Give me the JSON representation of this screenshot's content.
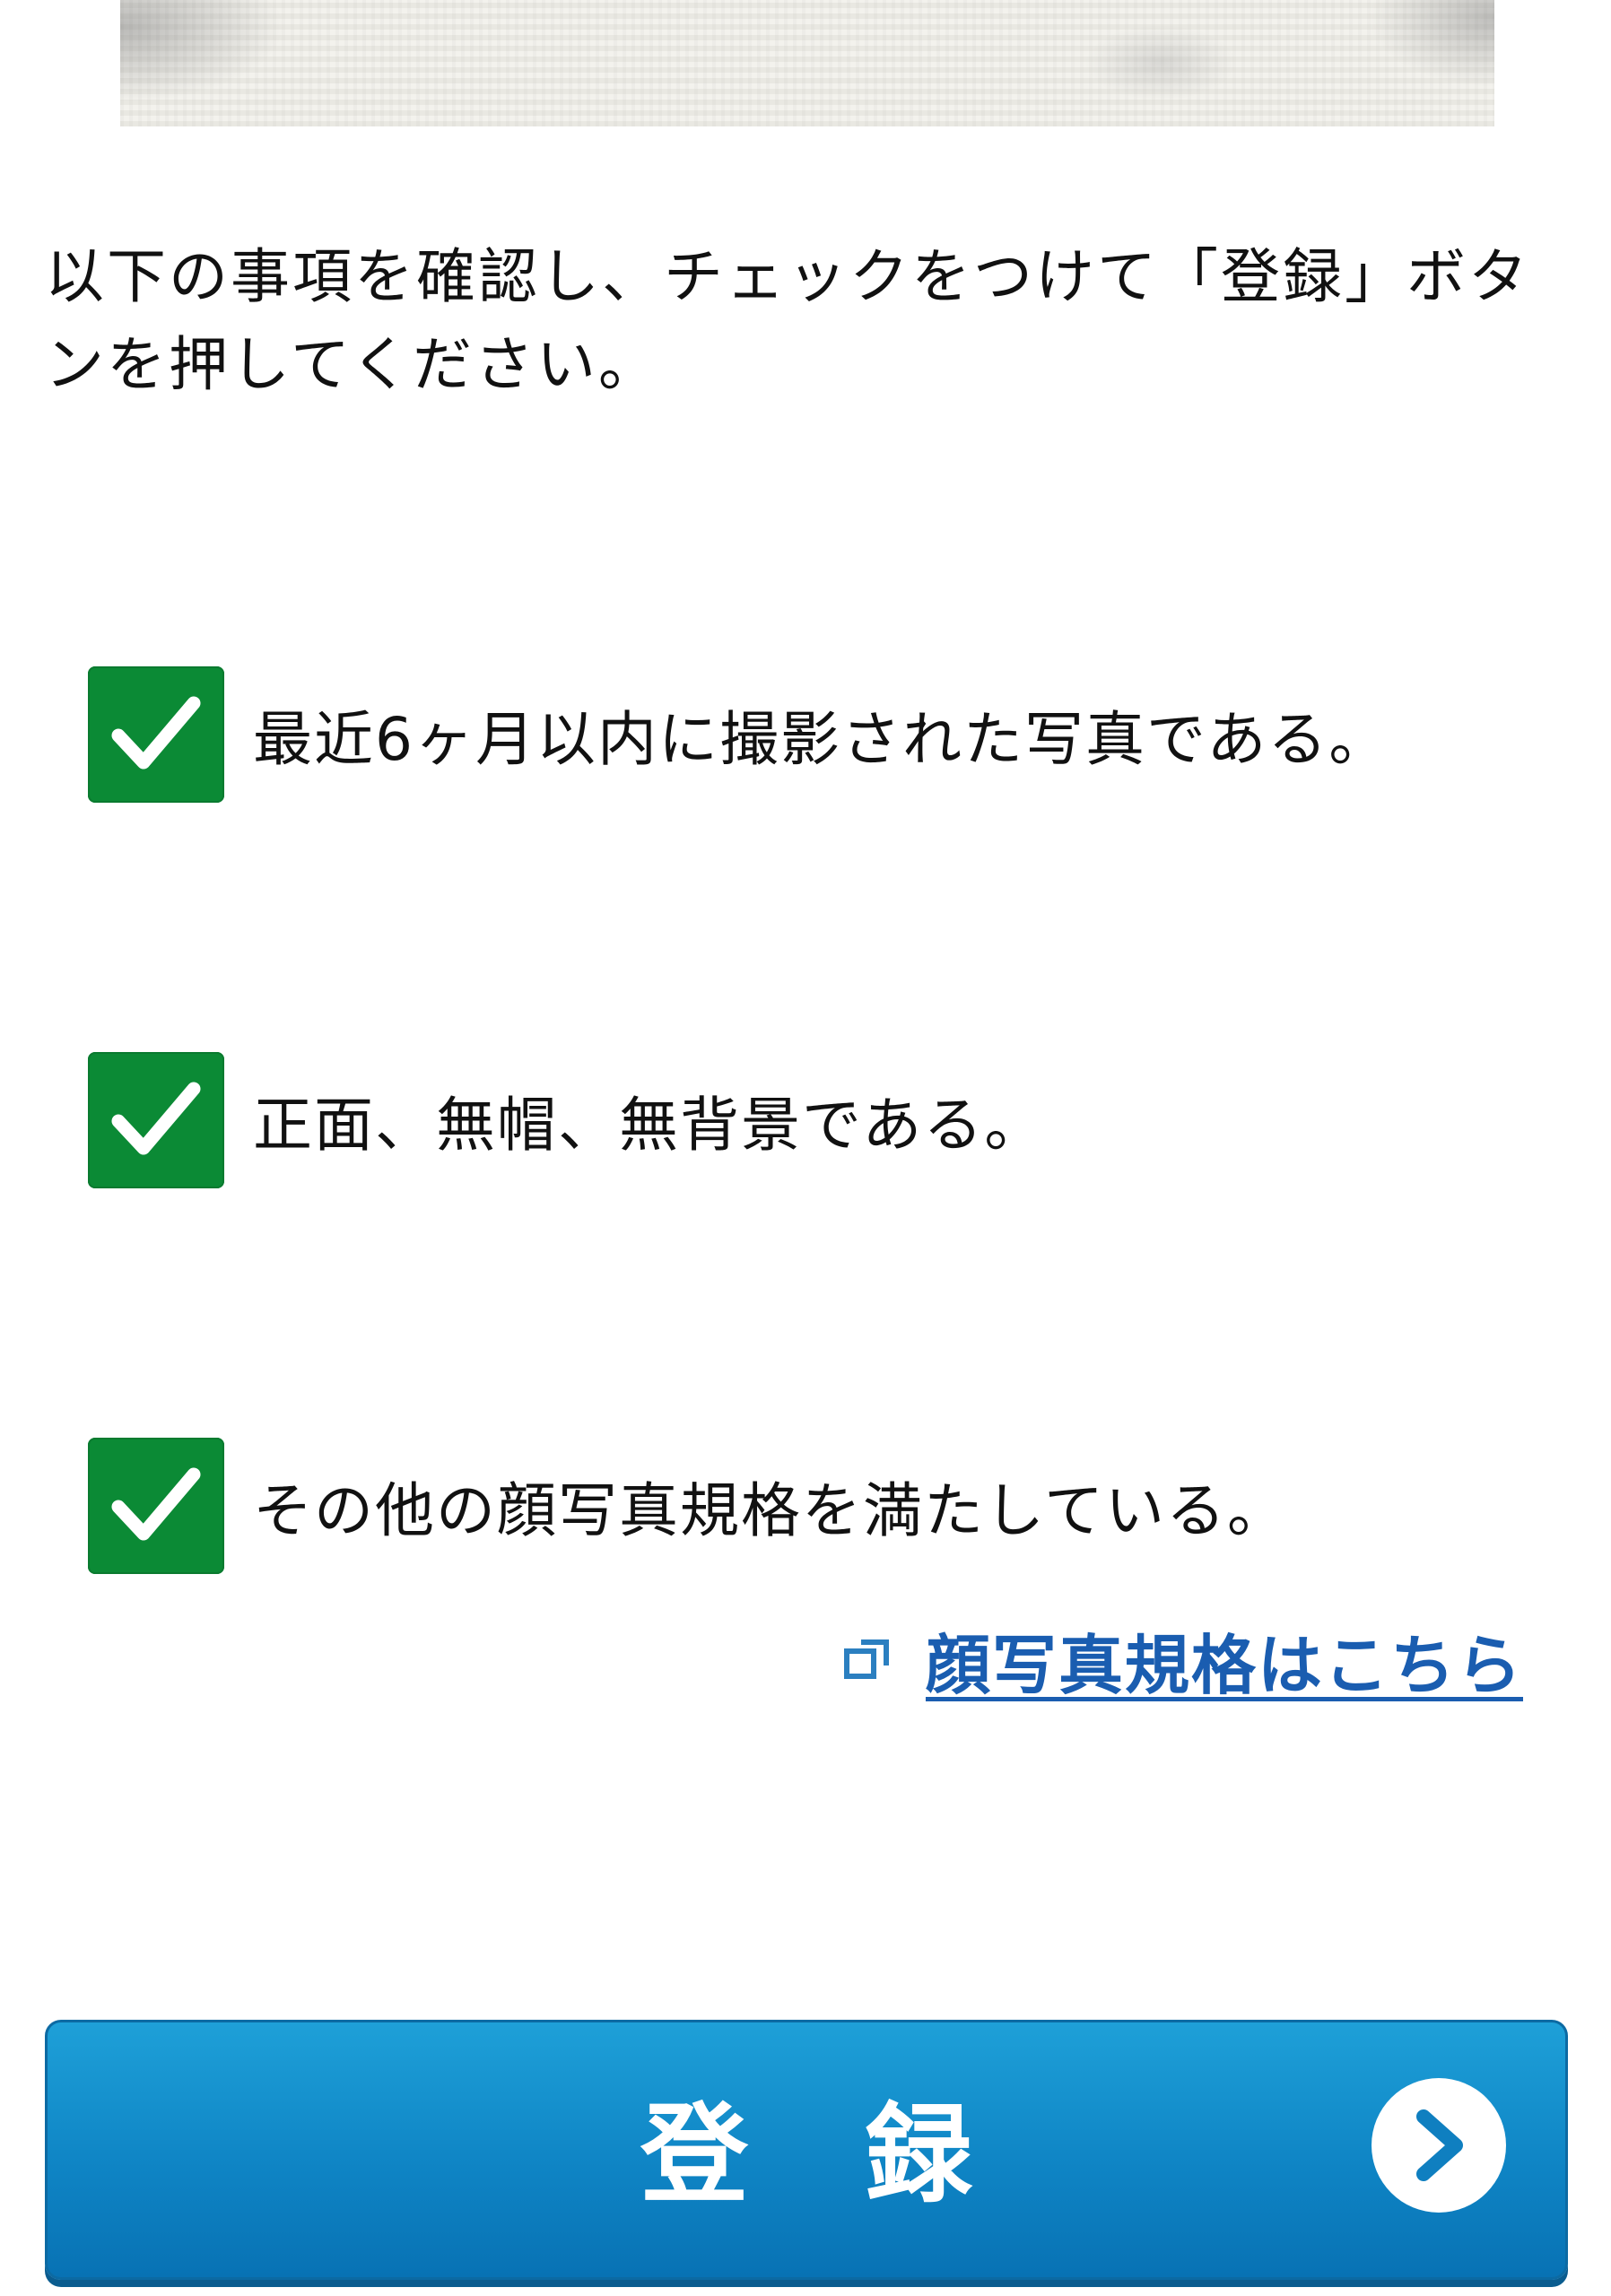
{
  "instruction": "以下の事項を確認し、チェックをつけて「登録」ボタンを押してください。",
  "checks": [
    {
      "label": "最近6ヶ月以内に撮影された写真である。",
      "checked": true
    },
    {
      "label": "正面、無帽、無背景である。",
      "checked": true
    },
    {
      "label": "その他の顔写真規格を満たしている。",
      "checked": true
    }
  ],
  "spec_link": {
    "label": "顔写真規格はこちら",
    "icon": "external-link-icon"
  },
  "register_button": {
    "label": "登録",
    "icon": "chevron-right-icon"
  },
  "colors": {
    "checkbox": "#0b8a35",
    "link": "#1a5db0",
    "button": "#0f85c5"
  }
}
